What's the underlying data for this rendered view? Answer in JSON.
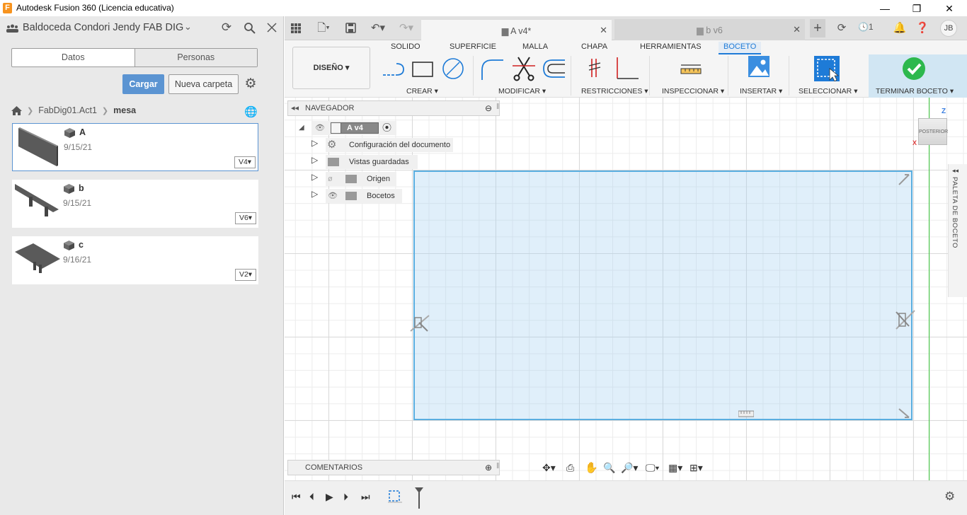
{
  "window": {
    "title": "Autodesk Fusion 360 (Licencia educativa)",
    "app_icon": "F",
    "minimize": "—",
    "restore": "❐",
    "close": "✕"
  },
  "data_panel": {
    "team_name": "Baldoceda Condori Jendy FAB DIG",
    "tabs": [
      "Datos",
      "Personas"
    ],
    "upload_label": "Cargar",
    "new_folder_label": "Nueva carpeta",
    "breadcrumb": {
      "project": "FabDig01.Act1",
      "folder": "mesa"
    },
    "files": [
      {
        "name": "A",
        "date": "9/15/21",
        "version": "V4"
      },
      {
        "name": "b",
        "date": "9/15/21",
        "version": "V6"
      },
      {
        "name": "c",
        "date": "9/16/21",
        "version": "V2"
      }
    ]
  },
  "tabs": {
    "active": {
      "label": "A v4*"
    },
    "inactive": {
      "label": "b v6"
    },
    "job_count": "1",
    "user_initials": "JB"
  },
  "ribbon": {
    "workspace": "DISEÑO",
    "tabs": [
      "SOLIDO",
      "SUPERFICIE",
      "MALLA",
      "CHAPA",
      "HERRAMIENTAS",
      "BOCETO"
    ],
    "active_tab": "BOCETO",
    "groups": [
      "CREAR",
      "MODIFICAR",
      "RESTRICCIONES",
      "INSPECCIONAR",
      "INSERTAR",
      "SELECCIONAR",
      "TERMINAR BOCETO"
    ]
  },
  "browser": {
    "title": "NAVEGADOR",
    "root": "A v4",
    "items": [
      "Configuración del documento",
      "Vistas guardadas",
      "Origen",
      "Bocetos"
    ]
  },
  "comments": {
    "title": "COMENTARIOS"
  },
  "viewcube": {
    "face": "POSTERIOR",
    "axis_z": "Z",
    "axis_x": "X"
  },
  "sketch_palette": {
    "label": "PALETA DE BOCETO"
  },
  "colors": {
    "accent": "#1e7bd7",
    "sketch_line": "#5aaee0",
    "terminar_check": "#2db84d",
    "upload_button": "#5b94d2"
  }
}
